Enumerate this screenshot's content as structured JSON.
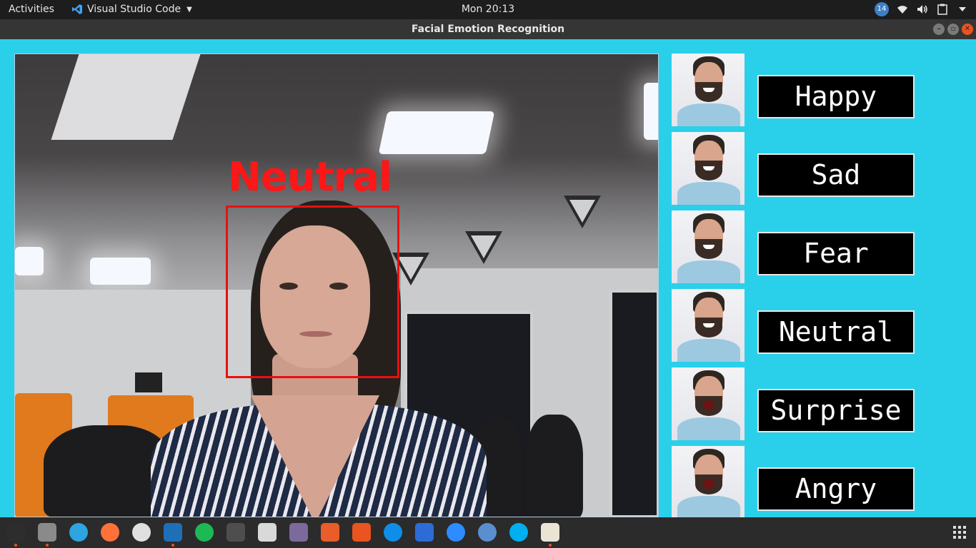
{
  "topbar": {
    "activities": "Activities",
    "app_name": "Visual Studio Code",
    "clock": "Mon 20:13",
    "notification_count": "14"
  },
  "window": {
    "title": "Facial Emotion Recognition"
  },
  "detection": {
    "label": "Neutral",
    "label_color": "#ff1616",
    "box_color": "#e81010"
  },
  "emotions": [
    {
      "label": "Happy",
      "icon": "happy-face"
    },
    {
      "label": "Sad",
      "icon": "sad-face"
    },
    {
      "label": "Fear",
      "icon": "fear-face"
    },
    {
      "label": "Neutral",
      "icon": "neutral-face"
    },
    {
      "label": "Surprise",
      "icon": "surprise-face"
    },
    {
      "label": "Angry",
      "icon": "angry-face"
    }
  ],
  "colors": {
    "background": "#2ad0ea",
    "button_bg": "#000000",
    "button_text": "#ffffff"
  },
  "dock": {
    "apps": [
      "terminal",
      "files",
      "telegram",
      "firefox",
      "chrome",
      "vscode",
      "spotify",
      "sublime-text",
      "music-player",
      "screenshot",
      "calculator",
      "software-center",
      "teamviewer",
      "tasks",
      "zoom",
      "qbittorrent",
      "skype",
      "text-editor"
    ]
  }
}
